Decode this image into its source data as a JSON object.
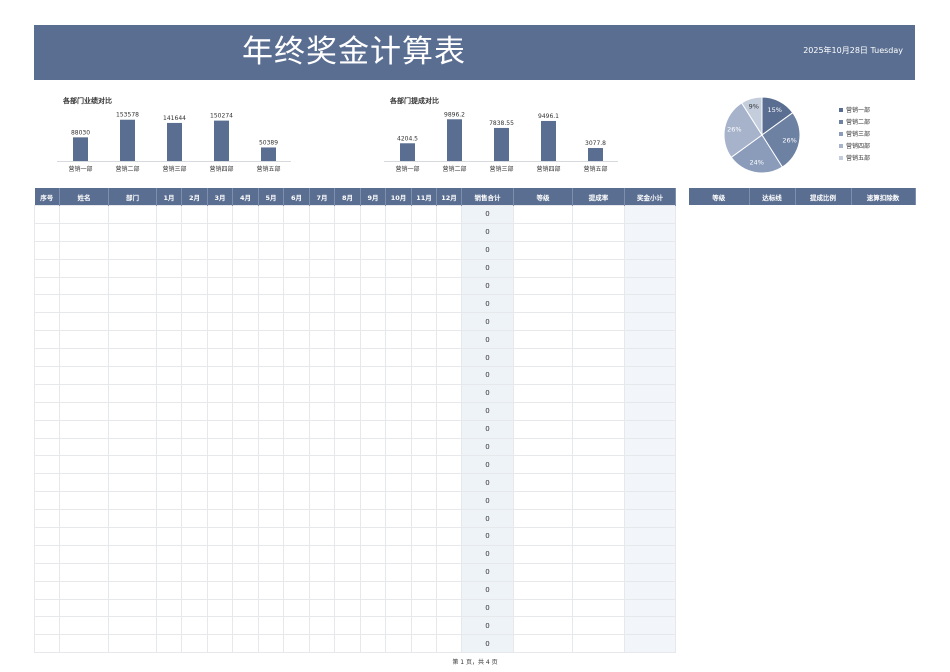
{
  "header": {
    "title": "年终奖金计算表",
    "date": "2025年10月28日 Tuesday"
  },
  "colors": {
    "accent": "#5a6e91"
  },
  "chart_data": [
    {
      "type": "bar",
      "title": "各部门业绩对比",
      "categories": [
        "营销一部",
        "营销二部",
        "营销三部",
        "营销四部",
        "营销五部"
      ],
      "values": [
        88030,
        153578,
        141644,
        150274,
        50389
      ],
      "value_labels": [
        "88030",
        "153578",
        "141644",
        "150274",
        "50389"
      ],
      "ylim": [
        0,
        160000
      ],
      "grid": false
    },
    {
      "type": "bar",
      "title": "各部门提成对比",
      "categories": [
        "营销一部",
        "营销二部",
        "营销三部",
        "营销四部",
        "营销五部"
      ],
      "values": [
        4204.5,
        9896.2,
        7838.55,
        9496.1,
        3077.8
      ],
      "value_labels": [
        "4204.5",
        "9896.2",
        "7838.55",
        "9496.1",
        "3077.8"
      ],
      "ylim": [
        0,
        10200
      ],
      "grid": false
    },
    {
      "type": "pie",
      "categories": [
        "营销一部",
        "营销二部",
        "营销三部",
        "营销四部",
        "营销五部"
      ],
      "values": [
        15,
        26,
        24,
        26,
        9
      ],
      "value_labels": [
        "15%",
        "26%",
        "24%",
        "26%",
        "9%"
      ],
      "colors": [
        "#5a6e91",
        "#6d81a3",
        "#8a9cba",
        "#a6b3cb",
        "#c4cddc"
      ],
      "legend": "right"
    }
  ],
  "main_table": {
    "headers": [
      "序号",
      "姓名",
      "部门",
      "1月",
      "2月",
      "3月",
      "4月",
      "5月",
      "6月",
      "7月",
      "8月",
      "9月",
      "10月",
      "11月",
      "12月",
      "销售合计",
      "等级",
      "提成率",
      "奖金小计"
    ],
    "totals": [
      "0",
      "0",
      "0",
      "0",
      "0",
      "0",
      "0",
      "0",
      "0",
      "0",
      "0",
      "0",
      "0",
      "0",
      "0",
      "0",
      "0",
      "0",
      "0",
      "0",
      "0",
      "0",
      "0",
      "0",
      "0"
    ]
  },
  "grade_table": {
    "headers": [
      "等级",
      "达标线",
      "提成比例",
      "速算扣除数"
    ]
  },
  "footer": {
    "page": "第 1 页，共 4 页"
  }
}
